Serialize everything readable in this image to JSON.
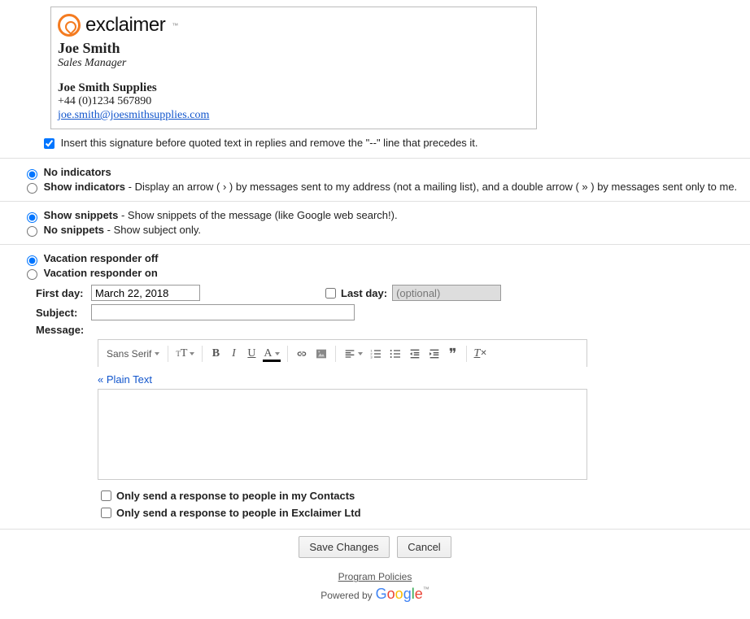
{
  "signature": {
    "logo_word": "exclaimer",
    "logo_tm": "™",
    "name": "Joe Smith",
    "title": "Sales Manager",
    "company": "Joe Smith Supplies",
    "phone": "+44 (0)1234 567890",
    "email": "joe.smith@joesmithsupplies.com",
    "insert_before_label": "Insert this signature before quoted text in replies and remove the \"--\" line that precedes it."
  },
  "indicators": {
    "no_label": "No indicators",
    "show_label": "Show indicators",
    "show_desc": " - Display an arrow ( › ) by messages sent to my address (not a mailing list), and a double arrow ( » ) by messages sent only to me."
  },
  "snippets": {
    "show_label": "Show snippets",
    "show_desc": " - Show snippets of the message (like Google web search!).",
    "no_label": "No snippets",
    "no_desc": " - Show subject only."
  },
  "vacation": {
    "off_label": "Vacation responder off",
    "on_label": "Vacation responder on",
    "first_day_label": "First day:",
    "first_day_value": "March 22, 2018",
    "last_day_label": "Last day:",
    "last_day_placeholder": "(optional)",
    "subject_label": "Subject:",
    "subject_value": "",
    "message_label": "Message:",
    "font_name": "Sans Serif",
    "plain_text": "« Plain Text",
    "contacts_label": "Only send a response to people in my Contacts",
    "org_label": "Only send a response to people in Exclaimer Ltd"
  },
  "buttons": {
    "save": "Save Changes",
    "cancel": "Cancel"
  },
  "footer": {
    "policies": "Program Policies",
    "powered": "Powered by"
  }
}
